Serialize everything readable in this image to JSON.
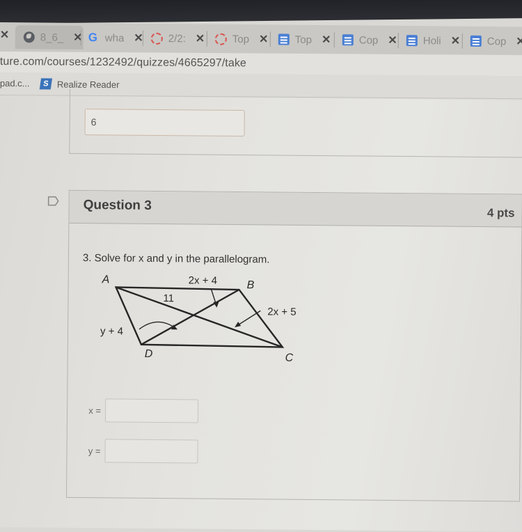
{
  "browser": {
    "tabs": [
      {
        "title": "8_6_",
        "icon": "globe-icon",
        "active": true
      },
      {
        "title": "wha",
        "icon": "google-icon"
      },
      {
        "title": "2/2:",
        "icon": "loading-ring-icon"
      },
      {
        "title": "Top",
        "icon": "loading-ring-icon"
      },
      {
        "title": "Top",
        "icon": "docs-icon"
      },
      {
        "title": "Cop",
        "icon": "docs-icon"
      },
      {
        "title": "Holi",
        "icon": "docs-icon"
      },
      {
        "title": "Cop",
        "icon": "docs-icon"
      }
    ],
    "close_glyph": "✕",
    "url": "ture.com/courses/1232492/quizzes/4665297/take",
    "bookmarks": [
      {
        "label": "pad.c..."
      },
      {
        "label": "Realize Reader",
        "icon_text": "S"
      }
    ]
  },
  "quiz": {
    "previous_answer_value": "6",
    "question": {
      "title": "Question 3",
      "points": "4 pts",
      "prompt": "3. Solve for x and y in the parallelogram.",
      "figure": {
        "vertices": {
          "a": "A",
          "b": "B",
          "c": "C",
          "d": "D"
        },
        "labels": {
          "top": "2x + 4",
          "ae": "11",
          "right": "2x + 5",
          "left": "y + 4"
        }
      },
      "answers": [
        {
          "label": "x =",
          "value": ""
        },
        {
          "label": "y =",
          "value": ""
        }
      ]
    }
  }
}
